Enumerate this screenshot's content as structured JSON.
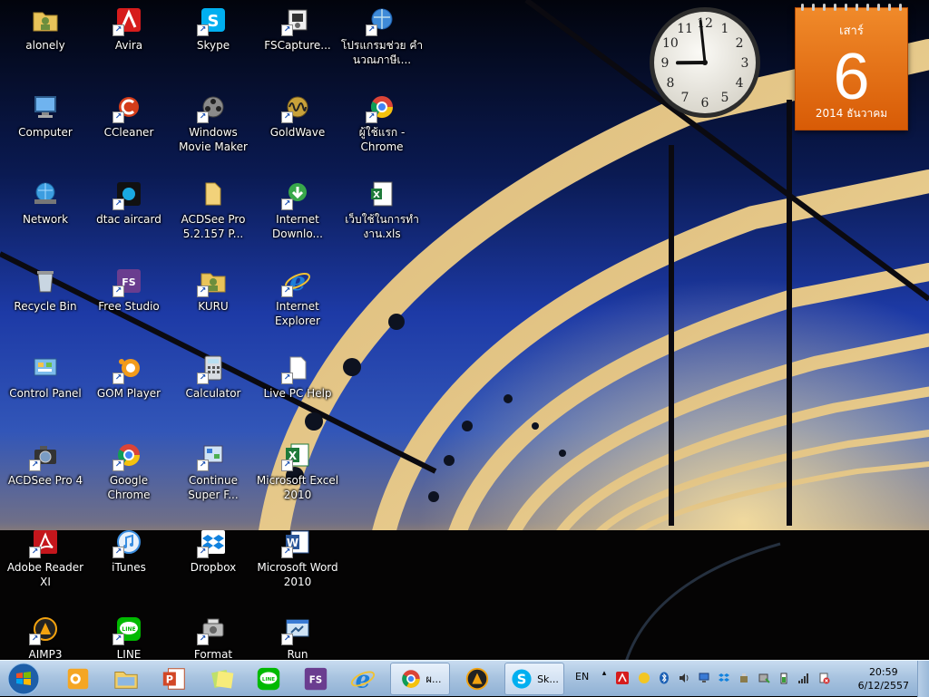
{
  "desktop_icons": [
    {
      "id": "alonely",
      "label": "alonely",
      "icon": "folder-user-icon"
    },
    {
      "id": "avira",
      "label": "Avira",
      "icon": "avira-icon"
    },
    {
      "id": "skype",
      "label": "Skype",
      "icon": "skype-icon"
    },
    {
      "id": "fscapture",
      "label": "FSCapture...",
      "icon": "fscapture-icon"
    },
    {
      "id": "thai-tax",
      "label": "โปรแกรมช่วย คำนวณภาษีเ...",
      "icon": "globe-app-icon"
    },
    {
      "id": "computer",
      "label": "Computer",
      "icon": "computer-icon"
    },
    {
      "id": "ccleaner",
      "label": "CCleaner",
      "icon": "ccleaner-icon"
    },
    {
      "id": "moviemaker",
      "label": "Windows Movie Maker",
      "icon": "film-reel-icon"
    },
    {
      "id": "goldwave",
      "label": "GoldWave",
      "icon": "goldwave-icon"
    },
    {
      "id": "chrome-user",
      "label": "ผู้ใช้แรก - Chrome",
      "icon": "chrome-icon"
    },
    {
      "id": "network",
      "label": "Network",
      "icon": "network-icon"
    },
    {
      "id": "dtac",
      "label": "dtac aircard",
      "icon": "dtac-icon"
    },
    {
      "id": "acdsee52",
      "label": "ACDSee Pro 5.2.157 P...",
      "icon": "folder-icon"
    },
    {
      "id": "idm",
      "label": "Internet Downlo...",
      "icon": "idm-icon"
    },
    {
      "id": "excel-file",
      "label": "เว็บใช้ในการทำ งาน.xls",
      "icon": "excel-file-icon"
    },
    {
      "id": "recycle",
      "label": "Recycle Bin",
      "icon": "recycle-bin-icon"
    },
    {
      "id": "freestudio",
      "label": "Free Studio",
      "icon": "free-studio-icon"
    },
    {
      "id": "kuru",
      "label": "KURU",
      "icon": "folder-user-icon"
    },
    {
      "id": "ie",
      "label": "Internet Explorer",
      "icon": "ie-icon"
    },
    {
      "id": "controlpanel",
      "label": "Control Panel",
      "icon": "control-panel-icon"
    },
    {
      "id": "gom",
      "label": "GOM Player",
      "icon": "gom-icon"
    },
    {
      "id": "calculator",
      "label": "Calculator",
      "icon": "calculator-icon"
    },
    {
      "id": "livepc",
      "label": "Live PC Help",
      "icon": "document-icon"
    },
    {
      "id": "acdsee4",
      "label": "ACDSee Pro 4",
      "icon": "camera-icon"
    },
    {
      "id": "chrome",
      "label": "Google Chrome",
      "icon": "chrome-icon"
    },
    {
      "id": "superf",
      "label": "Continue Super F...",
      "icon": "continue-icon"
    },
    {
      "id": "excel2010",
      "label": "Microsoft Excel 2010",
      "icon": "excel-icon"
    },
    {
      "id": "adobe",
      "label": "Adobe Reader XI",
      "icon": "adobe-reader-icon"
    },
    {
      "id": "itunes",
      "label": "iTunes",
      "icon": "itunes-icon"
    },
    {
      "id": "dropbox",
      "label": "Dropbox",
      "icon": "dropbox-icon"
    },
    {
      "id": "word2010",
      "label": "Microsoft Word 2010",
      "icon": "word-icon"
    },
    {
      "id": "aimp3",
      "label": "AIMP3",
      "icon": "aimp-icon"
    },
    {
      "id": "line",
      "label": "LINE",
      "icon": "line-icon"
    },
    {
      "id": "format",
      "label": "Format",
      "icon": "format-icon"
    },
    {
      "id": "run",
      "label": "Run",
      "icon": "run-icon"
    }
  ],
  "gadgets": {
    "clock": {
      "hour": 8,
      "minute": 59,
      "numerals": [
        "12",
        "1",
        "2",
        "3",
        "4",
        "5",
        "6",
        "7",
        "8",
        "9",
        "10",
        "11"
      ]
    },
    "calendar": {
      "day_of_week": "เสาร์",
      "day": "6",
      "month_year": "2014 ธันวาคม"
    }
  },
  "taskbar": {
    "start_icon": "windows-start-icon",
    "buttons": [
      {
        "id": "outlook",
        "icon": "outlook-icon"
      },
      {
        "id": "explorer",
        "icon": "explorer-icon"
      },
      {
        "id": "powerpoint",
        "icon": "powerpoint-icon"
      },
      {
        "id": "sticky",
        "icon": "sticky-notes-icon"
      },
      {
        "id": "line",
        "icon": "line-icon"
      },
      {
        "id": "freestudio",
        "icon": "free-studio-icon"
      },
      {
        "id": "ie",
        "icon": "ie-icon"
      },
      {
        "id": "chrome",
        "icon": "chrome-icon",
        "title": "ผ...",
        "active": true
      },
      {
        "id": "aimp",
        "icon": "aimp-icon"
      },
      {
        "id": "skype",
        "icon": "skype-icon",
        "title": "Sk...",
        "active": true
      }
    ],
    "tray": {
      "language": "EN",
      "icons": [
        "avira-tray-icon",
        "norton-tray-icon",
        "bluetooth-icon",
        "volume-icon",
        "network-tray-icon",
        "dropbox-tray-icon",
        "usb-icon",
        "safely-remove-icon",
        "power-icon",
        "signal-icon",
        "action-center-icon"
      ],
      "time": "20:59",
      "date": "6/12/2557"
    }
  }
}
